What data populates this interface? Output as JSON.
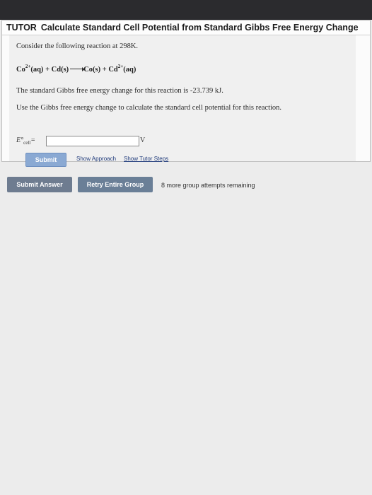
{
  "tutor": {
    "tag": "TUTOR",
    "title": "Calculate Standard Cell Potential from Standard Gibbs Free Energy Change"
  },
  "problem": {
    "intro": "Consider the following reaction at 298K.",
    "reaction": {
      "r1": "Co",
      "r1_charge": "2+",
      "r1_state": "(aq)",
      "plus1": " + ",
      "r2": "Cd(s)",
      "p1": "Co(s)",
      "plus2": " + ",
      "p2": "Cd",
      "p2_charge": "2+",
      "p2_state": "(aq)"
    },
    "gibbs_text": "The standard Gibbs free energy change for this reaction is -23.739 kJ.",
    "instruction": "Use the Gibbs free energy change to calculate the standard cell potential for this reaction.",
    "ecell_symbol": "E°",
    "ecell_sub": "cell",
    "ecell_eq": "=",
    "input_value": "",
    "unit": "V"
  },
  "actions": {
    "submit": "Submit",
    "show_approach": "Show Approach",
    "show_tutor_steps": "Show Tutor Steps"
  },
  "footer": {
    "submit_answer": "Submit Answer",
    "retry_group": "Retry Entire Group",
    "attempts_text": "8 more group attempts remaining"
  }
}
